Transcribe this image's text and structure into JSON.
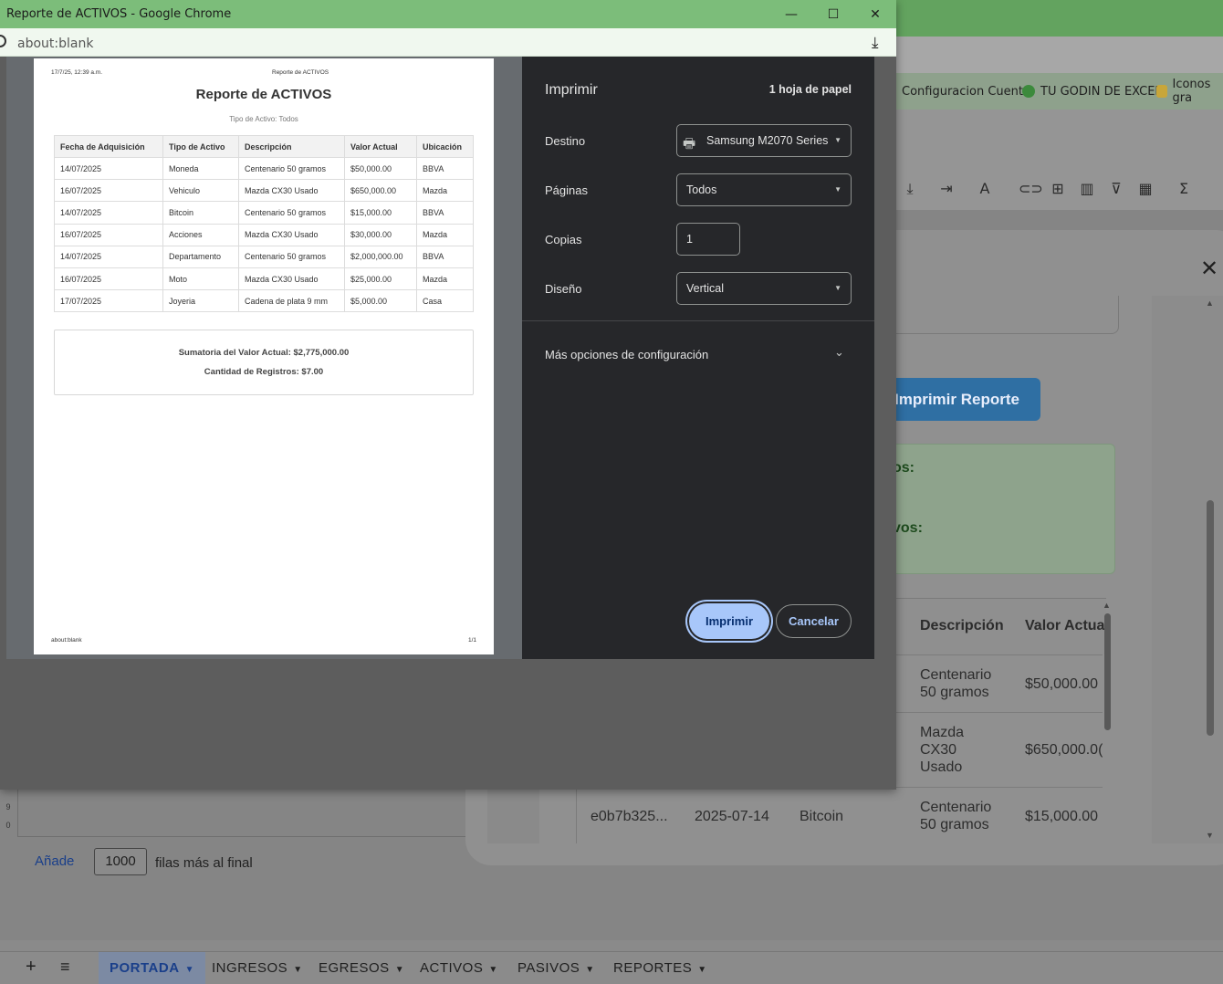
{
  "chrome": {
    "window_title": "Reporte de ACTIVOS - Google Chrome",
    "address": "about:blank",
    "minimize_icon": "minimize-icon",
    "maximize_icon": "maximize-icon",
    "close_icon": "close-icon"
  },
  "preview": {
    "header_date": "17/7/25, 12:39 a.m.",
    "header_title": "Reporte de ACTIVOS",
    "title": "Reporte de ACTIVOS",
    "subtitle": "Tipo de Activo: Todos",
    "columns": [
      "Fecha de Adquisición",
      "Tipo de Activo",
      "Descripción",
      "Valor Actual",
      "Ubicación"
    ],
    "rows": [
      [
        "14/07/2025",
        "Moneda",
        "Centenario 50 gramos",
        "$50,000.00",
        "BBVA"
      ],
      [
        "16/07/2025",
        "Vehiculo",
        "Mazda CX30 Usado",
        "$650,000.00",
        "Mazda"
      ],
      [
        "14/07/2025",
        "Bitcoin",
        "Centenario 50 gramos",
        "$15,000.00",
        "BBVA"
      ],
      [
        "16/07/2025",
        "Acciones",
        "Mazda CX30 Usado",
        "$30,000.00",
        "Mazda"
      ],
      [
        "14/07/2025",
        "Departamento",
        "Centenario 50 gramos",
        "$2,000,000.00",
        "BBVA"
      ],
      [
        "16/07/2025",
        "Moto",
        "Mazda CX30 Usado",
        "$25,000.00",
        "Mazda"
      ],
      [
        "17/07/2025",
        "Joyeria",
        "Cadena de plata 9 mm",
        "$5,000.00",
        "Casa"
      ]
    ],
    "summary_total": "Sumatoria del Valor Actual: $2,775,000.00",
    "summary_count": "Cantidad de Registros: $7.00",
    "footer_left": "about:blank",
    "footer_right": "1/1"
  },
  "print_panel": {
    "title": "Imprimir",
    "sheets": "1 hoja de papel",
    "destination_label": "Destino",
    "destination_value": "Samsung M2070 Series",
    "pages_label": "Páginas",
    "pages_value": "Todos",
    "copies_label": "Copias",
    "copies_value": "1",
    "layout_label": "Diseño",
    "layout_value": "Vertical",
    "more_options": "Más opciones de configuración",
    "print_button": "Imprimir",
    "cancel_button": "Cancelar"
  },
  "background": {
    "bookmarks": [
      "Configuracion Cuenta",
      "TU GODIN DE EXCEL",
      "Iconos gra"
    ],
    "add_rows_link": "Añade",
    "add_rows_value": "1000",
    "add_rows_text": "filas más al final",
    "row_numbers": [
      "9",
      "0"
    ],
    "sheet_tabs": [
      "PORTADA",
      "INGRESOS",
      "EGRESOS",
      "ACTIVOS",
      "PASIVOS",
      "REPORTES"
    ],
    "dialog": {
      "print_report_button": "Imprimir Reporte",
      "green_label_1": "os:",
      "green_label_2": "vos:",
      "table_headers": [
        "Descripción",
        "Valor Actua"
      ],
      "rows": [
        {
          "id": "",
          "date": "",
          "type": "",
          "desc": "Centenario 50 gramos",
          "value": "$50,000.00"
        },
        {
          "id": "",
          "date": "",
          "type": "",
          "desc": "Mazda CX30 Usado",
          "value": "$650,000.0("
        },
        {
          "id": "e0b7b325...",
          "date": "2025-07-14",
          "type": "Bitcoin",
          "desc": "Centenario 50 gramos",
          "value": "$15,000.00"
        }
      ]
    }
  }
}
